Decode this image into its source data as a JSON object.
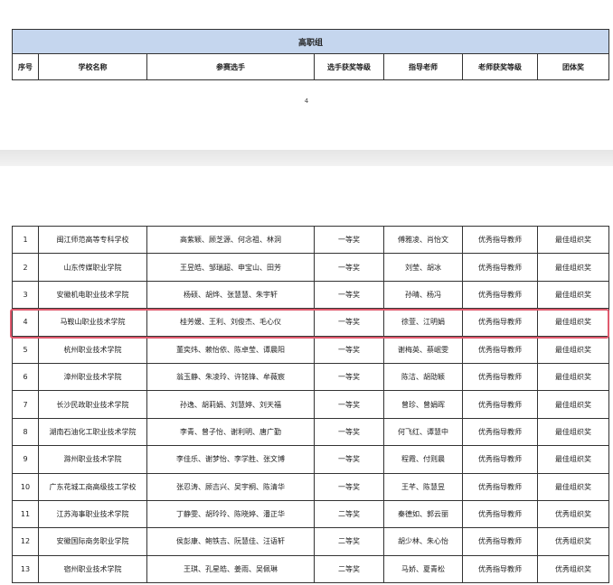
{
  "header": {
    "group_title": "高职组",
    "columns": [
      "序号",
      "学校名称",
      "参赛选手",
      "选手获奖等级",
      "指导老师",
      "老师获奖等级",
      "团体奖"
    ]
  },
  "page_number": "4",
  "rows": [
    [
      "1",
      "闽江师范高等专科学校",
      "高紫颖、顾芝源、何念祖、林洞",
      "一等奖",
      "傅雅凌、肖怡文",
      "优秀指导教师",
      "最佳组织奖"
    ],
    [
      "2",
      "山东传媒职业学院",
      "王昱皓、邹瑞超、申宝山、田芳",
      "一等奖",
      "刘莹、胡冰",
      "优秀指导教师",
      "最佳组织奖"
    ],
    [
      "3",
      "安徽机电职业技术学院",
      "杨硕、胡烨、张慧慧、朱宇轩",
      "一等奖",
      "孙晴、杨冯",
      "优秀指导教师",
      "最佳组织奖"
    ],
    [
      "4",
      "马鞍山职业技术学院",
      "桂芳媛、王利、刘俊杰、毛心仪",
      "一等奖",
      "徐萱、江明娟",
      "优秀指导教师",
      "最佳组织奖"
    ],
    [
      "5",
      "杭州职业技术学院",
      "董奕炜、赖怡依、陈卓莹、谭晨阳",
      "一等奖",
      "谢梅英、蔡岷雯",
      "优秀指导教师",
      "最佳组织奖"
    ],
    [
      "6",
      "漳州职业技术学院",
      "翁玉静、朱凌玲、许铭锋、牟薇宸",
      "一等奖",
      "陈洁、胡劭颖",
      "优秀指导教师",
      "最佳组织奖"
    ],
    [
      "7",
      "长沙民政职业技术学院",
      "孙逸、胡莉娟、刘慧婷、刘天福",
      "一等奖",
      "曾珍、曾娟晖",
      "优秀指导教师",
      "最佳组织奖"
    ],
    [
      "8",
      "湖南石油化工职业技术学院",
      "李青、曾子怡、谢利明、唐广勤",
      "一等奖",
      "何飞红、谭慧中",
      "优秀指导教师",
      "最佳组织奖"
    ],
    [
      "9",
      "滁州职业技术学院",
      "李佳乐、谢梦怡、李学胜、张文博",
      "一等奖",
      "程霞、付则晨",
      "优秀指导教师",
      "最佳组织奖"
    ],
    [
      "10",
      "广东花城工商高级技工学校",
      "张忍涛、顾吉兴、吴宇桐、陈清华",
      "一等奖",
      "王芊、陈慧昱",
      "优秀指导教师",
      "最佳组织奖"
    ],
    [
      "11",
      "江苏海事职业技术学院",
      "丁静雯、胡玲玲、陈晓婷、潘正华",
      "二等奖",
      "秦德如、郭云丽",
      "优秀指导教师",
      "优秀组织奖"
    ],
    [
      "12",
      "安徽国际商务职业学院",
      "侯彭康、鲍铁吉、阮慧佳、汪语轩",
      "二等奖",
      "胡少林、朱心怡",
      "优秀指导教师",
      "优秀组织奖"
    ],
    [
      "13",
      "宿州职业技术学院",
      "王琪、孔星皓、姜雨、吴佩琳",
      "二等奖",
      "马娇、夏青松",
      "优秀指导教师",
      "优秀组织奖"
    ]
  ]
}
